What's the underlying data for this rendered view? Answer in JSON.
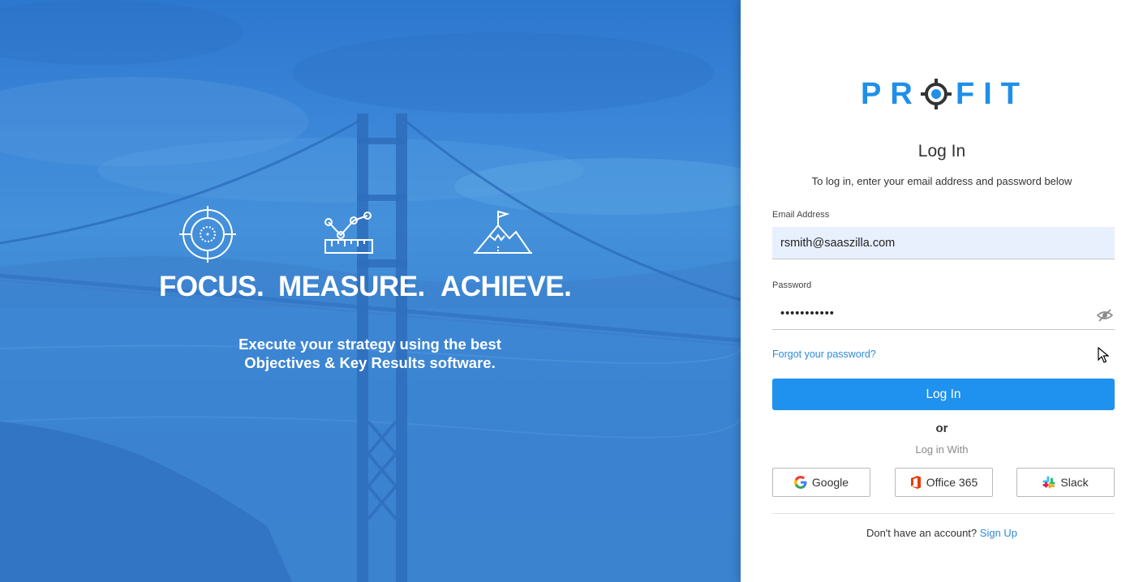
{
  "hero": {
    "pillars": [
      {
        "word": "FOCUS.",
        "icon": "target-icon"
      },
      {
        "word": "MEASURE.",
        "icon": "chart-ruler-icon"
      },
      {
        "word": "ACHIEVE.",
        "icon": "mountain-flag-icon"
      }
    ],
    "tagline_line1": "Execute your strategy using the best",
    "tagline_line2": "Objectives & Key Results software."
  },
  "login": {
    "brand": "PROFIT",
    "brand_left": "PR",
    "brand_right": "FIT",
    "title": "Log In",
    "subtitle": "To log in, enter your email address and password below",
    "email_label": "Email Address",
    "email_value": "rsmith@saaszilla.com",
    "password_label": "Password",
    "password_value": "•••••••••••",
    "forgot_label": "Forgot your password?",
    "submit_label": "Log In",
    "or_label": "or",
    "login_with_label": "Log in With",
    "sso": [
      {
        "label": "Google",
        "icon": "google-icon"
      },
      {
        "label": "Office 365",
        "icon": "office-icon"
      },
      {
        "label": "Slack",
        "icon": "slack-icon"
      }
    ],
    "signup_prompt": "Don't have an account?",
    "signup_label": "Sign Up"
  },
  "colors": {
    "accent": "#1f91ee",
    "link": "#2e8ad8",
    "hero_blue": "#3b86d8",
    "autofill_bg": "#e8f0fe"
  }
}
